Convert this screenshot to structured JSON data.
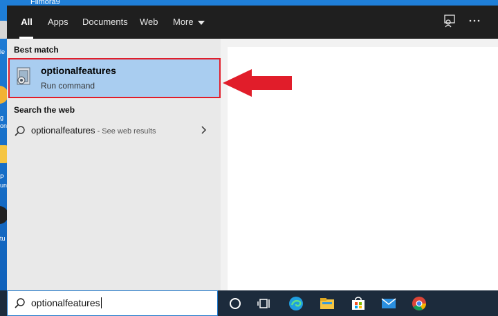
{
  "desktop": {
    "top_label": "Filmora9",
    "fragments": [
      "le",
      "g",
      "on",
      "P",
      "un",
      "tu"
    ]
  },
  "tabs": [
    {
      "label": "All",
      "active": true
    },
    {
      "label": "Apps",
      "active": false
    },
    {
      "label": "Documents",
      "active": false
    },
    {
      "label": "Web",
      "active": false
    },
    {
      "label": "More",
      "active": false
    }
  ],
  "top_icons": [
    "feedback-icon",
    "more-options-icon"
  ],
  "best_match": {
    "section_label": "Best match",
    "title": "optionalfeatures",
    "subtitle": "Run command",
    "icon": "run-command-icon"
  },
  "web": {
    "section_label": "Search the web",
    "query": "optionalfeatures",
    "suffix": " - See web results"
  },
  "annotation": {
    "arrow_color": "#e11d2a"
  },
  "taskbar": {
    "search_value": "optionalfeatures",
    "icons": [
      "cortana-icon",
      "task-view-icon",
      "edge-icon",
      "file-explorer-icon",
      "store-icon",
      "mail-icon",
      "chrome-icon"
    ]
  },
  "colors": {
    "accent": "#1a74c8",
    "highlight": "#a9cdf0",
    "topbar": "#1f1f1f",
    "taskbar": "#1c2b3c"
  }
}
